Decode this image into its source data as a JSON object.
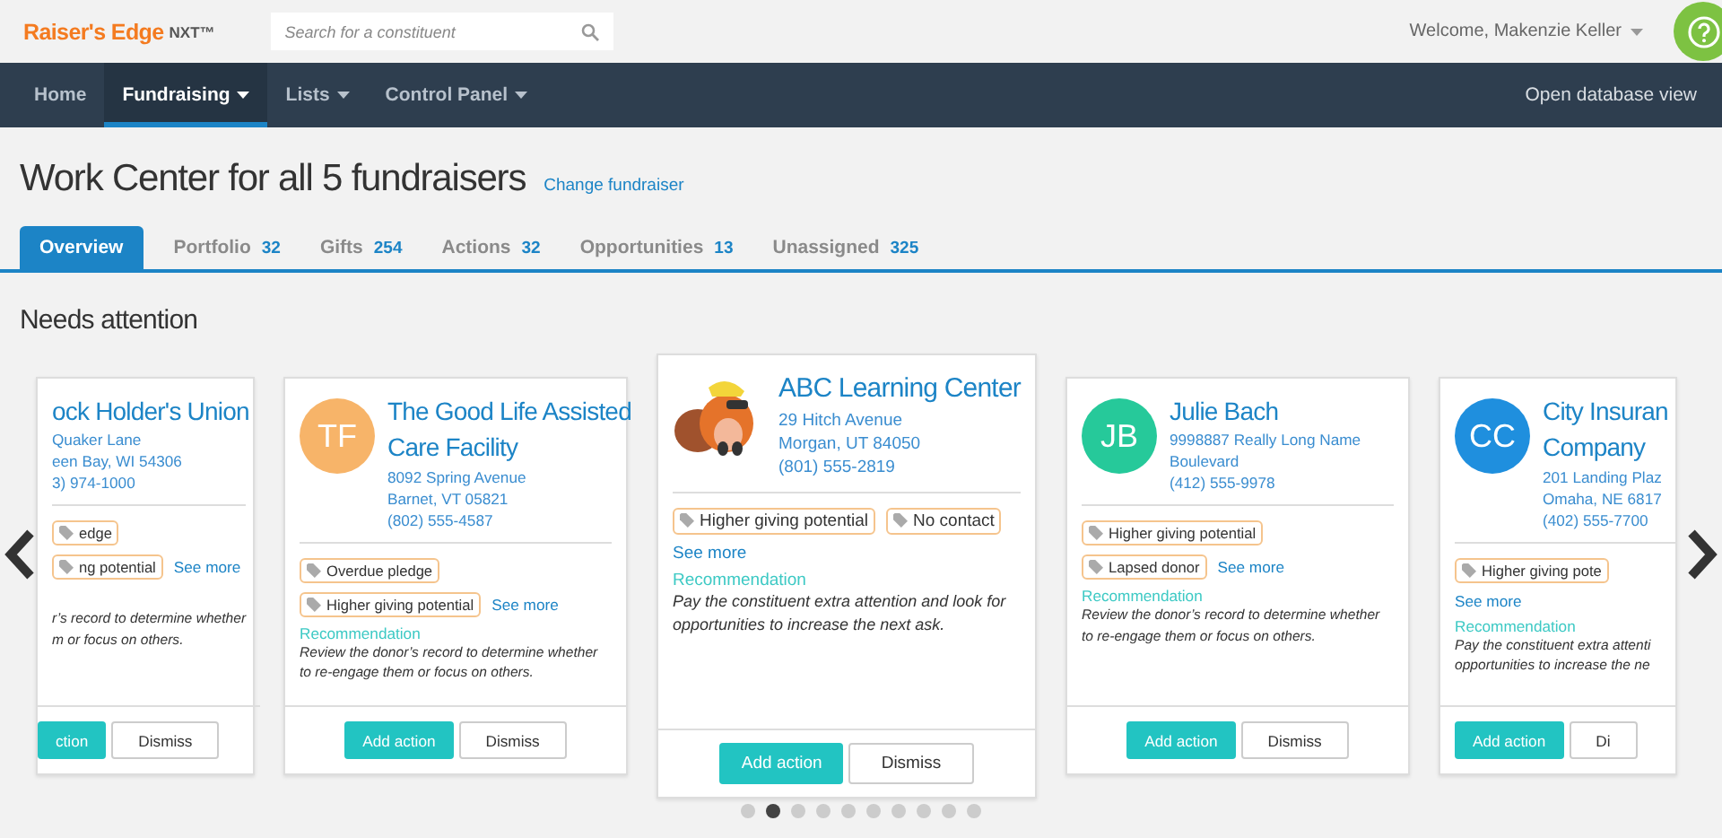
{
  "header": {
    "logo": "Raiser's Edge",
    "logo_suffix": "NXT™",
    "search": {
      "placeholder": "Search for a constituent"
    },
    "welcome": "Welcome, Makenzie Keller"
  },
  "nav": {
    "items": [
      {
        "label": "Home",
        "selected": false,
        "menu": false
      },
      {
        "label": "Fundraising",
        "selected": true,
        "menu": true
      },
      {
        "label": "Lists",
        "selected": false,
        "menu": true
      },
      {
        "label": "Control Panel",
        "selected": false,
        "menu": true
      }
    ],
    "right_link": "Open database view"
  },
  "title": "Work Center for all 5 fundraisers",
  "change_link": "Change fundraiser",
  "tabs": [
    {
      "label": "Overview",
      "selected": true
    },
    {
      "label": "Portfolio",
      "count": "32",
      "selected": false
    },
    {
      "label": "Gifts",
      "count": "254",
      "selected": false
    },
    {
      "label": "Actions",
      "count": "32",
      "selected": false
    },
    {
      "label": "Opportunities",
      "count": "13",
      "selected": false
    },
    {
      "label": "Unassigned",
      "count": "325",
      "selected": false
    }
  ],
  "section_title": "Needs attention",
  "cards": [
    {
      "featured": false,
      "name_lines": [
        "ock Holder's Union"
      ],
      "address": [
        "Quaker Lane",
        "een Bay, WI 54306",
        "3) 974-1000"
      ],
      "tag_rows": [
        [
          {
            "kind": "tag",
            "text": "edge"
          }
        ],
        [
          {
            "kind": "tag",
            "text": "ng potential"
          },
          {
            "kind": "link",
            "text": "See more"
          }
        ]
      ],
      "recommendation": "r’s record to determine whether\nm or focus on others.",
      "buttons": [
        "ction",
        "Dismiss"
      ]
    },
    {
      "featured": false,
      "avatar": {
        "kind": "initials",
        "text": "TF",
        "color": "#f7b469"
      },
      "name_lines": [
        "The Good Life Assisted",
        "Care Facility"
      ],
      "address": [
        "8092 Spring Avenue",
        "Barnet, VT 05821",
        "(802) 555-4587"
      ],
      "tag_rows": [
        [
          {
            "kind": "tag",
            "text": "Overdue pledge"
          }
        ],
        [
          {
            "kind": "tag",
            "text": "Higher giving potential"
          },
          {
            "kind": "link",
            "text": "See more"
          }
        ]
      ],
      "recommendation_label": "Recommendation",
      "recommendation": "Review the donor’s record to determine whether to re-engage them or focus on others.",
      "buttons": [
        "Add action",
        "Dismiss"
      ]
    },
    {
      "featured": true,
      "avatar": {
        "kind": "mascot"
      },
      "name_lines": [
        "ABC Learning Center"
      ],
      "address": [
        "29 Hitch Avenue",
        "Morgan, UT 84050",
        "(801) 555-2819"
      ],
      "tag_rows": [
        [
          {
            "kind": "tag",
            "text": "Higher giving potential"
          },
          {
            "kind": "tag",
            "text": "No contact"
          }
        ],
        [
          {
            "kind": "link",
            "text": "See more"
          }
        ]
      ],
      "recommendation_label": "Recommendation",
      "recommendation": "Pay the constituent extra attention and look for opportunities to increase the next ask.",
      "buttons": [
        "Add action",
        "Dismiss"
      ]
    },
    {
      "featured": false,
      "avatar": {
        "kind": "initials",
        "text": "JB",
        "color": "#26c99a"
      },
      "name_lines": [
        "Julie Bach"
      ],
      "address": [
        "9998887 Really Long Name Boulevard",
        "(412) 555-9978"
      ],
      "tag_rows": [
        [
          {
            "kind": "tag",
            "text": "Higher giving potential"
          }
        ],
        [
          {
            "kind": "tag",
            "text": "Lapsed donor"
          },
          {
            "kind": "link",
            "text": "See more"
          }
        ]
      ],
      "recommendation_label": "Recommendation",
      "recommendation": "Review the donor’s record to determine whether to re-engage them or focus on others.",
      "buttons": [
        "Add action",
        "Dismiss"
      ]
    },
    {
      "featured": false,
      "avatar": {
        "kind": "initials",
        "text": "CC",
        "color": "#1f8fde"
      },
      "name_lines": [
        "City Insuran",
        "Company"
      ],
      "address": [
        "201 Landing Plaz",
        "Omaha, NE 6817",
        "(402) 555-7700"
      ],
      "tag_rows": [
        [
          {
            "kind": "tag",
            "text": "Higher giving pote"
          }
        ],
        [
          {
            "kind": "link",
            "text": "See more"
          }
        ]
      ],
      "recommendation_label": "Recommendation",
      "recommendation": "Pay the constituent extra attenti\nopportunities to increase the ne",
      "buttons": [
        "Add action",
        "Di"
      ]
    }
  ],
  "dots": [
    {
      "selected": false
    },
    {
      "selected": true
    },
    {
      "selected": false
    },
    {
      "selected": false
    },
    {
      "selected": false
    },
    {
      "selected": false
    },
    {
      "selected": false
    },
    {
      "selected": false
    },
    {
      "selected": false
    },
    {
      "selected": false
    }
  ]
}
